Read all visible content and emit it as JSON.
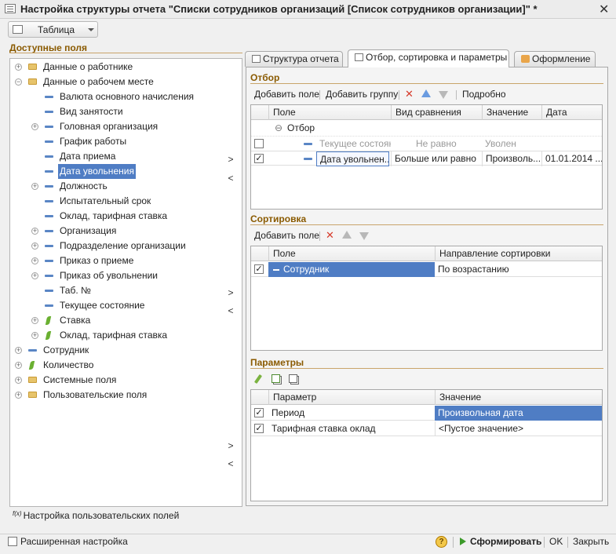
{
  "window": {
    "title": "Настройка структуры отчета \"Списки сотрудников организаций [Список сотрудников организации]\" *",
    "close": "✕"
  },
  "view_select": {
    "value": "Таблица"
  },
  "available_fields": {
    "label": "Доступные поля",
    "items": [
      {
        "label": "Данные о работнике",
        "icon": "folder",
        "expand": "+"
      },
      {
        "label": "Данные о рабочем месте",
        "icon": "folder",
        "expand": "−"
      },
      {
        "label": "Валюта основного начисления",
        "icon": "field"
      },
      {
        "label": "Вид занятости",
        "icon": "field"
      },
      {
        "label": "Головная организация",
        "icon": "field",
        "expand": "+"
      },
      {
        "label": "График работы",
        "icon": "field"
      },
      {
        "label": "Дата приема",
        "icon": "field"
      },
      {
        "label": "Дата увольнения",
        "icon": "field",
        "selected": true
      },
      {
        "label": "Должность",
        "icon": "field",
        "expand": "+"
      },
      {
        "label": "Испытательный срок",
        "icon": "field"
      },
      {
        "label": "Оклад, тарифная ставка",
        "icon": "field"
      },
      {
        "label": "Организация",
        "icon": "field",
        "expand": "+"
      },
      {
        "label": "Подразделение организации",
        "icon": "field",
        "expand": "+"
      },
      {
        "label": "Приказ о приеме",
        "icon": "field",
        "expand": "+"
      },
      {
        "label": "Приказ об увольнении",
        "icon": "field",
        "expand": "+"
      },
      {
        "label": "Таб. №",
        "icon": "field"
      },
      {
        "label": "Текущее состояние",
        "icon": "field"
      },
      {
        "label": "Ставка",
        "icon": "resource",
        "expand": "+"
      },
      {
        "label": "Оклад, тарифная ставка",
        "icon": "resource",
        "expand": "+"
      },
      {
        "label": "Сотрудник",
        "icon": "field",
        "expand": "+"
      },
      {
        "label": "Количество",
        "icon": "resource",
        "expand": "+"
      },
      {
        "label": "Системные поля",
        "icon": "folder",
        "expand": "+"
      },
      {
        "label": "Пользовательские поля",
        "icon": "folder",
        "expand": "+"
      }
    ],
    "user_fields_link": "Настройка пользовательских полей",
    "fx": "f(x)"
  },
  "transfer": {
    "add": ">",
    "remove": "<"
  },
  "tabs": [
    {
      "label": "Структура отчета",
      "icon": "structure-icon"
    },
    {
      "label": "Отбор, сортировка и параметры",
      "icon": "filter-icon",
      "active": true
    },
    {
      "label": "Оформление",
      "icon": "design-icon"
    }
  ],
  "filter": {
    "label": "Отбор",
    "toolbar": {
      "add_field": "Добавить поле",
      "add_group": "Добавить группу",
      "details": "Подробно"
    },
    "columns": [
      "Поле",
      "Вид сравнения",
      "Значение",
      "Дата"
    ],
    "group_row": {
      "expand": "⊖",
      "label": "Отбор"
    },
    "rows": [
      {
        "checked": false,
        "field": "Текущее состояние",
        "comparison": "Не равно",
        "value": "Уволен",
        "date": "",
        "muted": true
      },
      {
        "checked": true,
        "field": "Дата увольнен...",
        "comparison": "Больше или равно",
        "value": "Произволь...",
        "date": "01.01.2014 ..."
      }
    ]
  },
  "sorting": {
    "label": "Сортировка",
    "toolbar": {
      "add_field": "Добавить поле"
    },
    "columns": [
      "Поле",
      "Направление сортировки"
    ],
    "rows": [
      {
        "checked": true,
        "field": "Сотрудник",
        "direction": "По возрастанию"
      }
    ]
  },
  "parameters": {
    "label": "Параметры",
    "columns": [
      "Параметр",
      "Значение"
    ],
    "rows": [
      {
        "checked": true,
        "name": "Период",
        "value": "Произвольная дата"
      },
      {
        "checked": true,
        "name": "Тарифная ставка оклад",
        "value": "<Пустое значение>"
      }
    ]
  },
  "footer": {
    "advanced": "Расширенная настройка",
    "help": "?",
    "generate": "Сформировать",
    "ok": "OK",
    "close": "Закрыть"
  },
  "colors": {
    "selection": "#4f7dc4",
    "section_label": "#8a5a00",
    "accent_green": "#3c9a2a",
    "delete_red": "#d63a2a"
  }
}
